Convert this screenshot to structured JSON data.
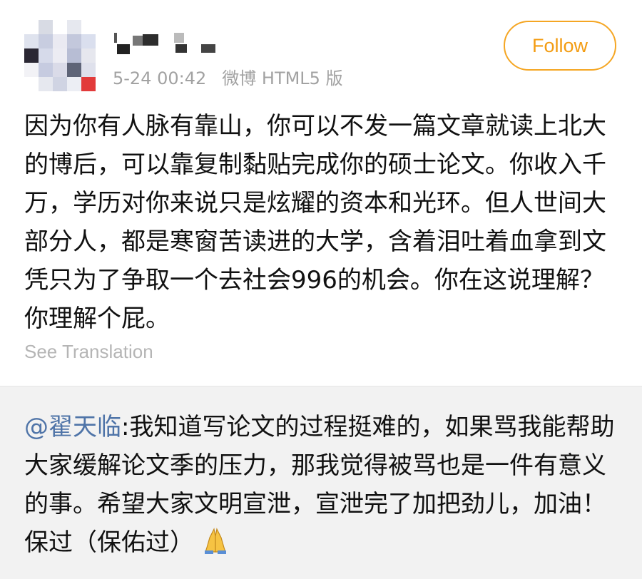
{
  "post": {
    "timestamp": "5-24 00:42",
    "source": "微博 HTML5 版",
    "follow_label": "Follow",
    "body": "因为你有人脉有靠山，你可以不发一篇文章就读上北大的博后，可以靠复制黏贴完成你的硕士论文。你收入千万，学历对你来说只是炫耀的资本和光环。但人世间大部分人，都是寒窗苦读进的大学，含着泪吐着血拿到文凭只为了争取一个去社会996的机会。你在这说理解？你理解个屁。",
    "see_translation": "See Translation"
  },
  "reply": {
    "mention": "@翟天临",
    "text": ":我知道写论文的过程挺难的，如果骂我能帮助大家缓解论文季的压力，那我觉得被骂也是一件有意义的事。希望大家文明宣泄，宣泄完了加把劲儿，加油！保过（保佑过）",
    "emoji_icon": "folded-hands-icon"
  },
  "avatar_colors": [
    "#ffffff",
    "#d8dbe4",
    "#ffffff",
    "#e6e8ef",
    "#ffffff",
    "#dfe3ee",
    "#c8cde0",
    "#eaeaf2",
    "#c3c8dc",
    "#dadfee",
    "#2a2733",
    "#d6daea",
    "#ececf3",
    "#b7bdd4",
    "#e6e7ee",
    "#f2f2f6",
    "#c6cbe0",
    "#dadbe8",
    "#5e6477",
    "#dfe1ec",
    "#ffffff",
    "#e6e8ef",
    "#d0d4e3",
    "#eceef4",
    "#e23b3b"
  ],
  "colors": {
    "accent": "#f5a623",
    "mention": "#4f74a8",
    "muted": "#a2a2a2"
  }
}
